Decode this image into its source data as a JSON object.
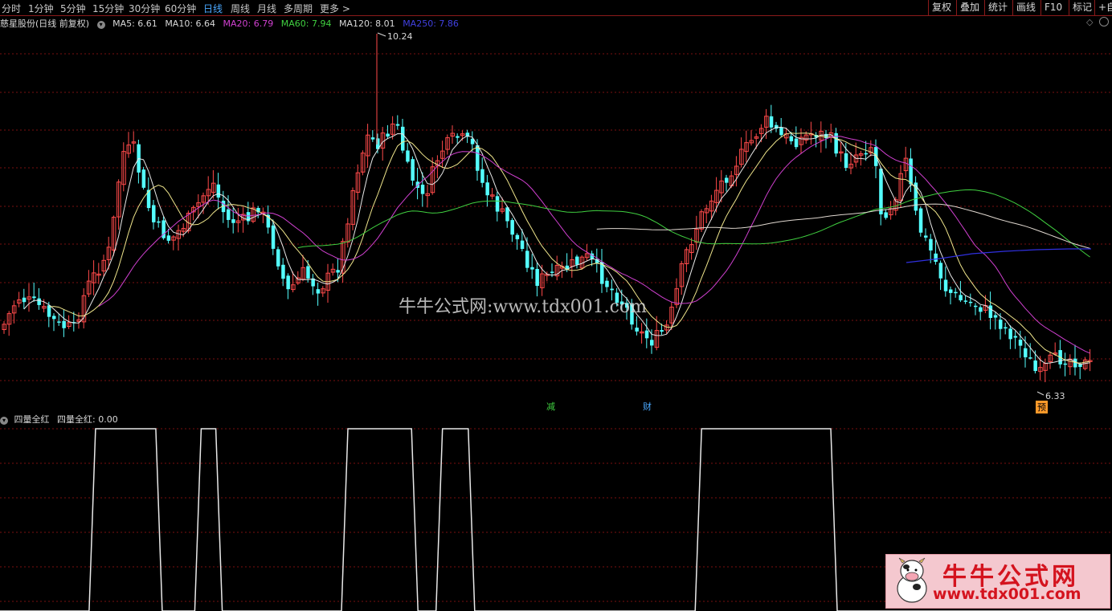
{
  "periods": [
    "分时",
    "1分钟",
    "5分钟",
    "15分钟",
    "30分钟",
    "60分钟",
    "日线",
    "周线",
    "月线",
    "多周期",
    "更多 >"
  ],
  "active_period": "日线",
  "toolbar": [
    "复权",
    "叠加",
    "统计",
    "画线",
    "F10",
    "标记",
    "+自"
  ],
  "stock_title": "慈星股份(日线 前复权)",
  "ma_items": [
    {
      "text": "MA5: 6.61",
      "color": "#d8d8d8"
    },
    {
      "text": "MA10: 6.64",
      "color": "#d8d8d8"
    },
    {
      "text": "MA20: 6.79",
      "color": "#d040d0"
    },
    {
      "text": "MA60: 7.94",
      "color": "#40d040"
    },
    {
      "text": "MA120: 8.01",
      "color": "#d8d8d8"
    },
    {
      "text": "MA250: 7.86",
      "color": "#4040e0"
    }
  ],
  "price_high_label": "10.24",
  "price_low_label": "6.33",
  "markers": {
    "reduce": "减",
    "finance": "财",
    "forecast": "预"
  },
  "indicator": {
    "name": "四量全红",
    "value_label": "四量全红: 0.00"
  },
  "watermark": "牛牛公式网:www.tdx001.com",
  "logo": {
    "title": "牛牛公式网",
    "url": "www.tdx001.com"
  },
  "colors": {
    "up": "#ff4a4a",
    "down": "#54ffff",
    "grid": "#7a1010",
    "ma20": "#d040d0",
    "ma60": "#40d040",
    "ma250": "#3030e0"
  },
  "chart_data": {
    "type": "candlestick",
    "y_range": [
      6.0,
      10.6
    ],
    "high_price": 10.24,
    "low_price": 6.33,
    "ma_values": {
      "MA5": 6.61,
      "MA10": 6.64,
      "MA20": 6.79,
      "MA60": 7.94,
      "MA120": 8.01,
      "MA250": 7.86
    },
    "indicator_series_name": "四量全红",
    "indicator_signal_blocks": [
      [
        0.083,
        0.143
      ],
      [
        0.178,
        0.197
      ],
      [
        0.31,
        0.373
      ],
      [
        0.395,
        0.424
      ],
      [
        0.628,
        0.75
      ]
    ]
  }
}
